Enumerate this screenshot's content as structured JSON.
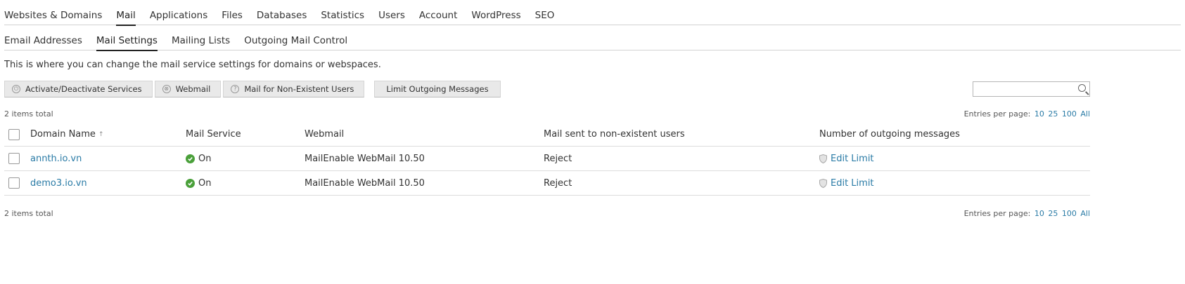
{
  "main_tabs": [
    {
      "label": "Websites & Domains",
      "active": false
    },
    {
      "label": "Mail",
      "active": true
    },
    {
      "label": "Applications",
      "active": false
    },
    {
      "label": "Files",
      "active": false
    },
    {
      "label": "Databases",
      "active": false
    },
    {
      "label": "Statistics",
      "active": false
    },
    {
      "label": "Users",
      "active": false
    },
    {
      "label": "Account",
      "active": false
    },
    {
      "label": "WordPress",
      "active": false
    },
    {
      "label": "SEO",
      "active": false
    }
  ],
  "sub_tabs": [
    {
      "label": "Email Addresses",
      "active": false
    },
    {
      "label": "Mail Settings",
      "active": true
    },
    {
      "label": "Mailing Lists",
      "active": false
    },
    {
      "label": "Outgoing Mail Control",
      "active": false
    }
  ],
  "hint": "This is where you can change the mail service settings for domains or webspaces.",
  "toolbar": {
    "activate_label": "Activate/Deactivate Services",
    "webmail_label": "Webmail",
    "nonexistent_label": "Mail for Non-Existent Users",
    "limit_label": "Limit Outgoing Messages"
  },
  "search": {
    "placeholder": "",
    "value": ""
  },
  "pagination": {
    "total_text": "2 items total",
    "entries_label": "Entries per page:",
    "options": [
      "10",
      "25",
      "100",
      "All"
    ]
  },
  "table": {
    "headers": {
      "domain": "Domain Name",
      "service": "Mail Service",
      "webmail": "Webmail",
      "nonexistent": "Mail sent to non-existent users",
      "outgoing": "Number of outgoing messages"
    },
    "sort_indicator": "↑",
    "rows": [
      {
        "domain": "annth.io.vn",
        "service": "On",
        "webmail": "MailEnable WebMail 10.50",
        "nonexistent": "Reject",
        "outgoing": "Edit Limit"
      },
      {
        "domain": "demo3.io.vn",
        "service": "On",
        "webmail": "MailEnable WebMail 10.50",
        "nonexistent": "Reject",
        "outgoing": "Edit Limit"
      }
    ]
  },
  "colors": {
    "link": "#2a7ba6",
    "ok": "#4aa03a"
  }
}
